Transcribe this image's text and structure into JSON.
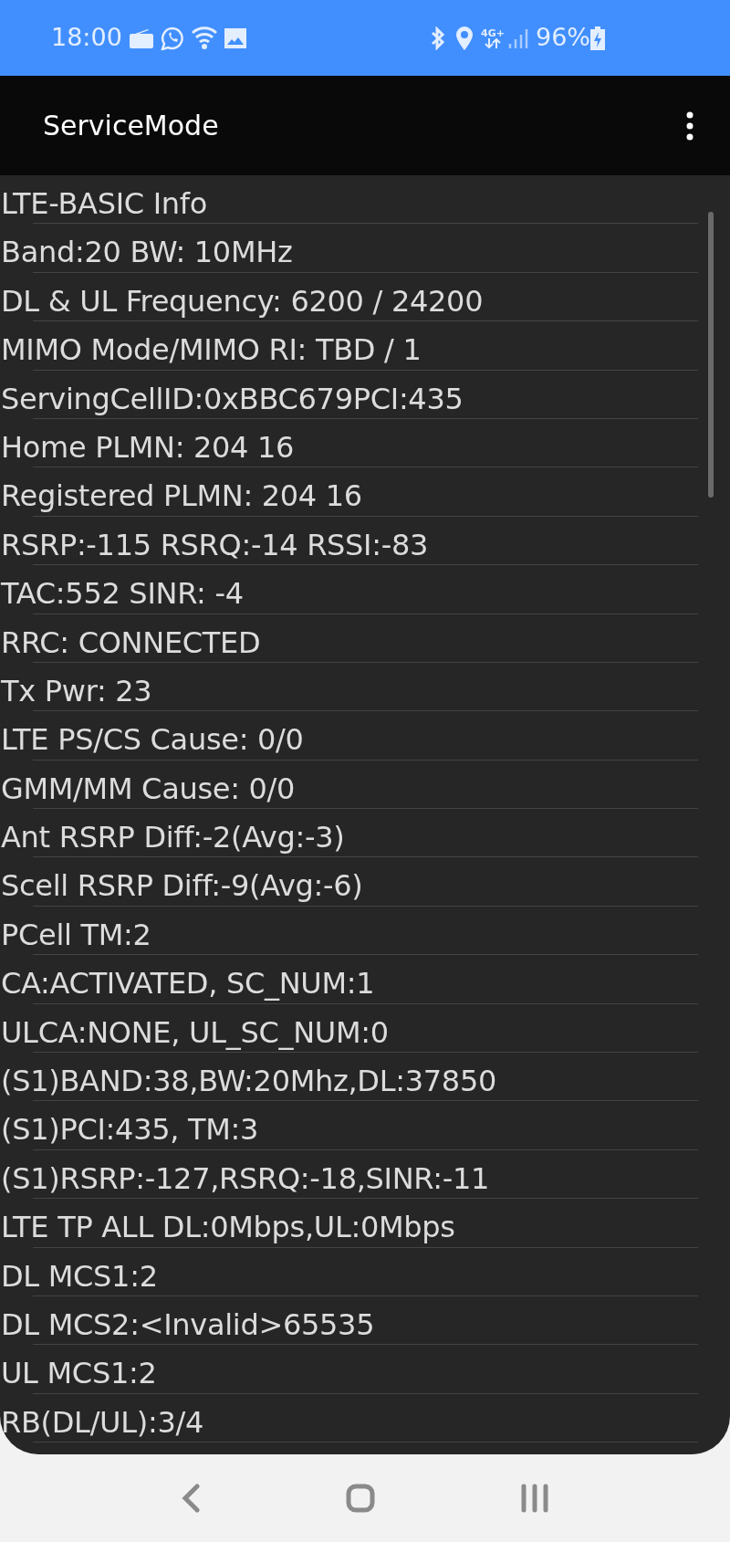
{
  "status_bar": {
    "time": "18:00",
    "network_type": "4G+",
    "battery": "96%"
  },
  "app_bar": {
    "title": "ServiceMode"
  },
  "rows": [
    "LTE-BASIC Info",
    "Band:20 BW: 10MHz",
    "DL & UL Frequency: 6200 / 24200",
    "MIMO Mode/MIMO RI: TBD / 1",
    "ServingCellID:0xBBC679PCI:435",
    "Home PLMN: 204 16",
    "Registered PLMN: 204 16",
    "RSRP:-115 RSRQ:-14 RSSI:-83",
    "TAC:552 SINR: -4",
    "RRC: CONNECTED",
    "Tx Pwr: 23",
    "LTE PS/CS Cause: 0/0",
    "GMM/MM Cause: 0/0",
    "Ant RSRP Diff:-2(Avg:-3)",
    "Scell RSRP Diff:-9(Avg:-6)",
    "PCell TM:2",
    "CA:ACTIVATED, SC_NUM:1",
    "ULCA:NONE, UL_SC_NUM:0",
    "(S1)BAND:38,BW:20Mhz,DL:37850",
    "(S1)PCI:435, TM:3",
    "(S1)RSRP:-127,RSRQ:-18,SINR:-11",
    "LTE TP ALL DL:0Mbps,UL:0Mbps",
    "DL MCS1:2",
    "DL MCS2:<Invalid>65535",
    "UL MCS1:2",
    "RB(DL/UL):3/4"
  ]
}
